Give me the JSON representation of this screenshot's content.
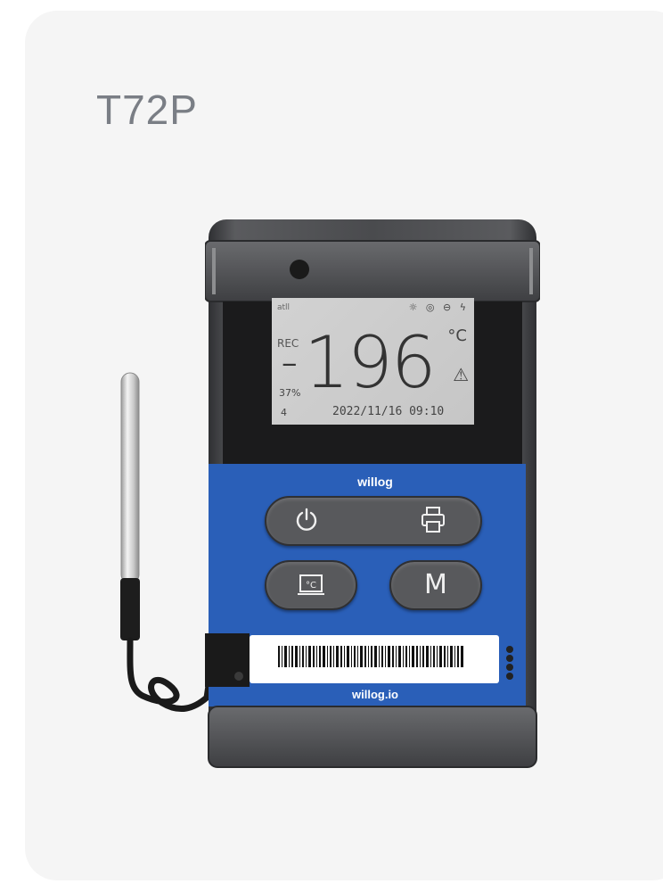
{
  "product": {
    "title": "T72P"
  },
  "display": {
    "signal": "atll",
    "status_icons": "☼ ◎ ⊖ ϟ",
    "rec_label": "REC",
    "sign": "-",
    "temperature": "196",
    "unit": "°C",
    "warning": "⚠",
    "humidity": "37%",
    "count": "4",
    "datetime": "2022/11/16  09:10"
  },
  "device": {
    "brand_top": "willog",
    "brand_bottom": "willog.io",
    "button_m_label": "M",
    "colors": {
      "body": "#3f4043",
      "blue_panel": "#2a5fb8",
      "screen": "#c8c8c8"
    },
    "icons": [
      "power-icon",
      "printer-icon",
      "temperature-screen-icon",
      "barcode-icon",
      "camera-lens-icon"
    ]
  }
}
